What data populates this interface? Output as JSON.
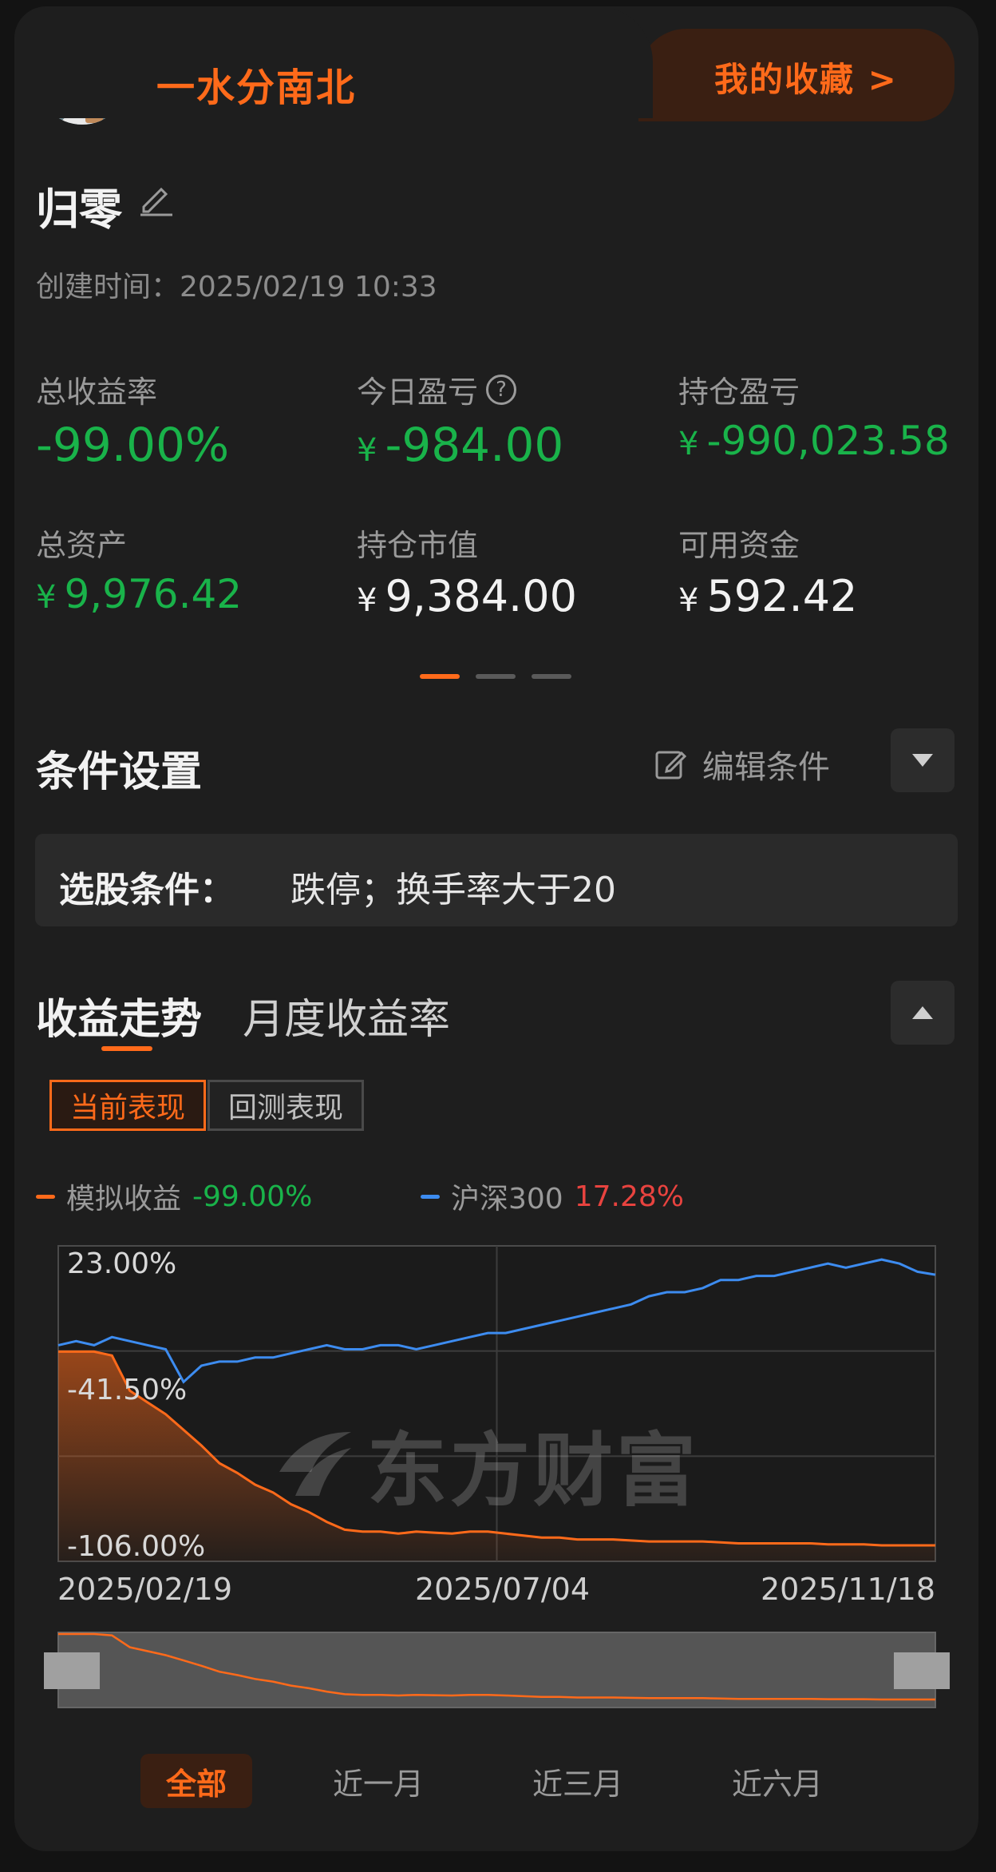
{
  "header": {
    "username": "一水分南北",
    "favorites_label": "我的收藏 >"
  },
  "strategy": {
    "title": "归零",
    "created": "创建时间：2025/02/19 10:33"
  },
  "metrics": [
    {
      "label": "总收益率",
      "value": "-99.00%",
      "currency": "",
      "color": "green"
    },
    {
      "label": "今日盈亏",
      "value": "-984.00",
      "currency": "¥",
      "color": "green",
      "help": "?"
    },
    {
      "label": "持仓盈亏",
      "value": "-990,023.58",
      "currency": "¥",
      "color": "green"
    },
    {
      "label": "总资产",
      "value": "9,976.42",
      "currency": "¥",
      "color": "green"
    },
    {
      "label": "持仓市值",
      "value": "9,384.00",
      "currency": "¥",
      "color": "white"
    },
    {
      "label": "可用资金",
      "value": "592.42",
      "currency": "¥",
      "color": "white"
    }
  ],
  "conditions": {
    "title": "条件设置",
    "edit_label": "编辑条件",
    "key": "选股条件：",
    "value": "跌停；换手率大于20"
  },
  "trend": {
    "tab_active": "收益走势",
    "tab_inactive": "月度收益率",
    "seg_active": "当前表现",
    "seg_inactive": "回测表现",
    "legend": [
      {
        "name": "模拟收益",
        "value": "-99.00%",
        "color": "#ff6a1a",
        "value_color": "#19b34a"
      },
      {
        "name": "沪深300",
        "value": "17.28%",
        "color": "#3d8cf0",
        "value_color": "#e8433f"
      }
    ],
    "watermark": "东方财富"
  },
  "chart_data": {
    "type": "line",
    "y_tick_labels": [
      "23.00%",
      "-41.50%",
      "-106.00%"
    ],
    "ylim": [
      -106,
      23
    ],
    "x_tick_labels": [
      "2025/02/19",
      "2025/07/04",
      "2025/11/18"
    ],
    "series": [
      {
        "name": "模拟收益",
        "color": "#ff6a1a",
        "values": [
          0,
          0,
          0,
          -2,
          -20,
          -26,
          -32,
          -40,
          -48,
          -57,
          -62,
          -68,
          -72,
          -78,
          -82,
          -87,
          -91,
          -92,
          -92,
          -93,
          -92,
          -92.5,
          -93,
          -92,
          -92,
          -93,
          -94,
          -95,
          -95,
          -96,
          -96,
          -96,
          -96.5,
          -97,
          -97,
          -97,
          -97,
          -97.5,
          -98,
          -98,
          -98,
          -98,
          -98,
          -98.5,
          -98.5,
          -98.5,
          -99,
          -99,
          -99,
          -99
        ]
      },
      {
        "name": "沪深300",
        "color": "#3d8cf0",
        "values": [
          0,
          1,
          0,
          2,
          1,
          0,
          -1,
          -9,
          -5,
          -4,
          -4,
          -3,
          -3,
          -2,
          -1,
          0,
          -1,
          -1,
          0,
          0,
          -1,
          0,
          1,
          2,
          3,
          3,
          4,
          5,
          6,
          7,
          8,
          9,
          10,
          12,
          13,
          13,
          14,
          16,
          16,
          17,
          17,
          18,
          19,
          20,
          19,
          20,
          21,
          20,
          18,
          17.28
        ]
      }
    ]
  },
  "ranges": [
    "全部",
    "近一月",
    "近三月",
    "近六月"
  ]
}
